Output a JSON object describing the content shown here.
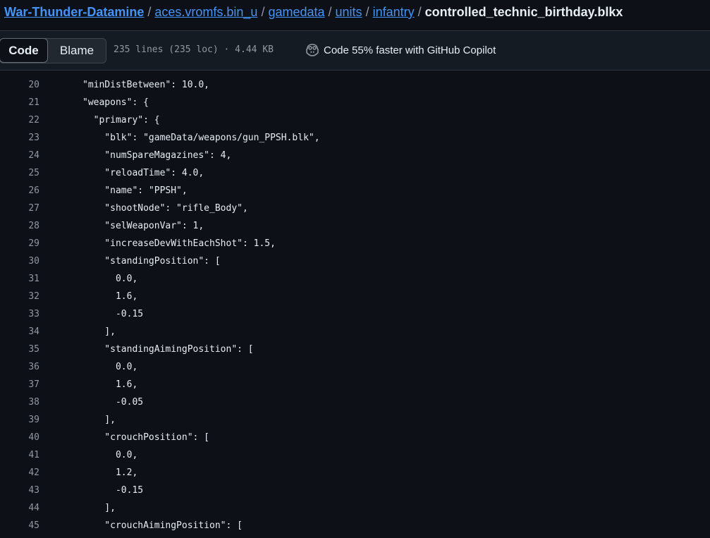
{
  "breadcrumb": {
    "repo": "War-Thunder-Datamine",
    "parts": [
      "aces.vromfs.bin_u",
      "gamedata",
      "units",
      "infantry"
    ],
    "separator": "/",
    "current_file": "controlled_technic_birthday.blkx"
  },
  "toolbar": {
    "code_label": "Code",
    "blame_label": "Blame",
    "file_meta": "235 lines (235 loc) · 4.44 KB",
    "copilot_label": "Code 55% faster with GitHub Copilot",
    "copilot_icon": "copilot-icon"
  },
  "code": {
    "lines": [
      {
        "n": "20",
        "text": "\"minDistBetween\": 10.0,"
      },
      {
        "n": "21",
        "text": "\"weapons\": {"
      },
      {
        "n": "22",
        "text": "  \"primary\": {"
      },
      {
        "n": "23",
        "text": "    \"blk\": \"gameData/weapons/gun_PPSH.blk\","
      },
      {
        "n": "24",
        "text": "    \"numSpareMagazines\": 4,"
      },
      {
        "n": "25",
        "text": "    \"reloadTime\": 4.0,"
      },
      {
        "n": "26",
        "text": "    \"name\": \"PPSH\","
      },
      {
        "n": "27",
        "text": "    \"shootNode\": \"rifle_Body\","
      },
      {
        "n": "28",
        "text": "    \"selWeaponVar\": 1,"
      },
      {
        "n": "29",
        "text": "    \"increaseDevWithEachShot\": 1.5,"
      },
      {
        "n": "30",
        "text": "    \"standingPosition\": ["
      },
      {
        "n": "31",
        "text": "      0.0,"
      },
      {
        "n": "32",
        "text": "      1.6,"
      },
      {
        "n": "33",
        "text": "      -0.15"
      },
      {
        "n": "34",
        "text": "    ],"
      },
      {
        "n": "35",
        "text": "    \"standingAimingPosition\": ["
      },
      {
        "n": "36",
        "text": "      0.0,"
      },
      {
        "n": "37",
        "text": "      1.6,"
      },
      {
        "n": "38",
        "text": "      -0.05"
      },
      {
        "n": "39",
        "text": "    ],"
      },
      {
        "n": "40",
        "text": "    \"crouchPosition\": ["
      },
      {
        "n": "41",
        "text": "      0.0,"
      },
      {
        "n": "42",
        "text": "      1.2,"
      },
      {
        "n": "43",
        "text": "      -0.15"
      },
      {
        "n": "44",
        "text": "    ],"
      },
      {
        "n": "45",
        "text": "    \"crouchAimingPosition\": ["
      }
    ]
  }
}
